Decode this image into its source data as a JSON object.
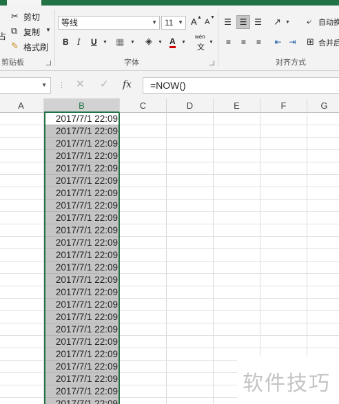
{
  "ribbon": {
    "clipboard": {
      "cut": "剪切",
      "copy": "复制",
      "format_painter": "格式刷",
      "paste_fragment": "占",
      "group_label": "剪贴板"
    },
    "font": {
      "font_name": "等线",
      "font_size": "11",
      "bold": "B",
      "italic": "I",
      "underline": "U",
      "font_color_glyph": "A",
      "grow_glyph": "A",
      "shrink_glyph": "A",
      "phonetic_top": "wén",
      "phonetic_bottom": "文",
      "group_label": "字体"
    },
    "alignment": {
      "wrap_text": "自动换",
      "merge_center": "合并后",
      "group_label": "对齐方式"
    }
  },
  "formula_bar": {
    "name_box": "",
    "cancel_glyph": "✕",
    "enter_glyph": "✓",
    "fx": "fx",
    "formula": "=NOW()"
  },
  "sheet": {
    "columns": [
      "A",
      "B",
      "C",
      "D",
      "E",
      "F",
      "G"
    ],
    "active_column": "B",
    "cell_value": "2017/7/1 22:09",
    "row_count": 24
  },
  "watermark": "软件技巧",
  "colors": {
    "accent": "#217346",
    "selection_fill": "#c5c5c5",
    "ribbon_bg": "#f3f3f3"
  }
}
